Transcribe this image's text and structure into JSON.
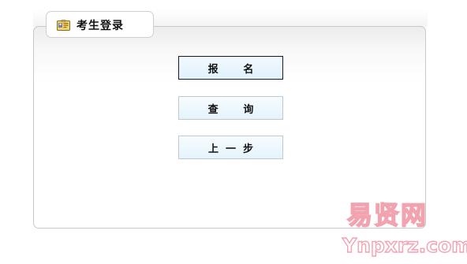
{
  "header": {
    "title": "考生登录",
    "icon": "id-card-icon"
  },
  "buttons": [
    {
      "label": "报       名",
      "active": true
    },
    {
      "label": "查       询",
      "active": false
    },
    {
      "label": "上  一  步",
      "active": false
    }
  ],
  "watermark": {
    "line1": "易贤网",
    "line2": "Ynpxrz.com"
  },
  "colors": {
    "panel_border": "#c8c8c8",
    "button_fill": "#e4f3fb",
    "watermark": "#f2a3b0"
  }
}
